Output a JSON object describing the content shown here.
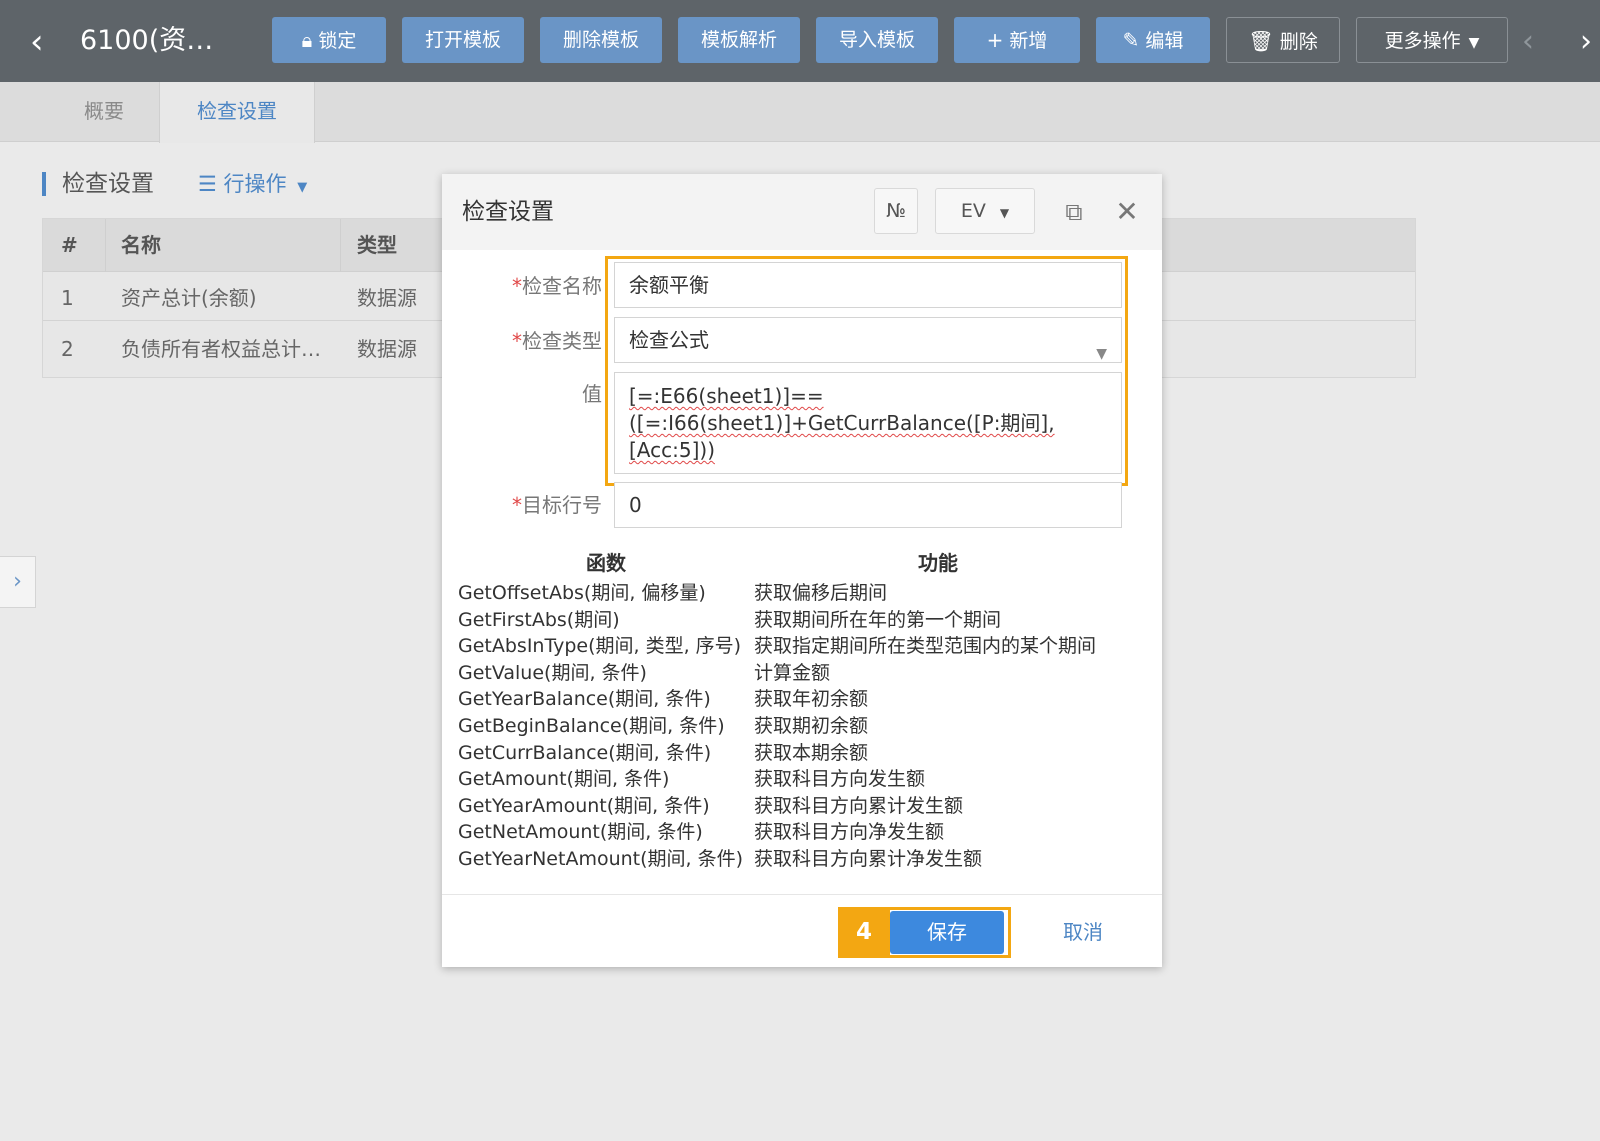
{
  "toolbar": {
    "title": "6100(资…",
    "buttons": {
      "lock": "锁定",
      "open_template": "打开模板",
      "delete_template": "删除模板",
      "parse_template": "模板解析",
      "import_template": "导入模板",
      "add": "新增",
      "edit": "编辑",
      "delete": "删除",
      "more": "更多操作"
    },
    "icons": {
      "back": "chevron-left-icon",
      "lock": "lock-icon",
      "add": "plus-icon",
      "edit": "edit-icon",
      "delete": "trash-icon",
      "more": "caret-down-icon",
      "prev": "chevron-left-icon",
      "next": "chevron-right-icon"
    }
  },
  "tabs": [
    {
      "label": "概要",
      "active": false
    },
    {
      "label": "检查设置",
      "active": true
    }
  ],
  "section": {
    "title": "检查设置",
    "row_ops": "行操作"
  },
  "table": {
    "columns": [
      "#",
      "名称",
      "类型"
    ],
    "rows": [
      {
        "num": "1",
        "name": "资产总计(余额)",
        "type": "数据源"
      },
      {
        "num": "2",
        "name": "负债所有者权益总计…",
        "type": "数据源"
      }
    ]
  },
  "modal": {
    "title": "检查设置",
    "header_buttons": {
      "no": "№",
      "ev": "EV"
    },
    "fields": {
      "name_label": "检查名称",
      "name_value": "余额平衡",
      "type_label": "检查类型",
      "type_value": "检查公式",
      "value_label": "值",
      "value_line1": "[=:E66(sheet1)]==",
      "value_line2": "([=:I66(sheet1)]+GetCurrBalance([P:期间], [Acc:5]))",
      "target_label": "目标行号",
      "target_value": "0"
    },
    "functions": {
      "col_func": "函数",
      "col_desc": "功能",
      "rows": [
        {
          "name": "GetOffsetAbs(期间, 偏移量)",
          "desc": "获取偏移后期间"
        },
        {
          "name": "GetFirstAbs(期间)",
          "desc": "获取期间所在年的第一个期间"
        },
        {
          "name": "GetAbsInType(期间, 类型, 序号)",
          "desc": "获取指定期间所在类型范围内的某个期间"
        },
        {
          "name": "GetValue(期间, 条件)",
          "desc": "计算金额"
        },
        {
          "name": "GetYearBalance(期间, 条件)",
          "desc": "获取年初余额"
        },
        {
          "name": "GetBeginBalance(期间, 条件)",
          "desc": "获取期初余额"
        },
        {
          "name": "GetCurrBalance(期间, 条件)",
          "desc": "获取本期余额"
        },
        {
          "name": "GetAmount(期间, 条件)",
          "desc": "获取科目方向发生额"
        },
        {
          "name": "GetYearAmount(期间, 条件)",
          "desc": "获取科目方向累计发生额"
        },
        {
          "name": "GetNetAmount(期间, 条件)",
          "desc": "获取科目方向净发生额"
        },
        {
          "name": "GetYearNetAmount(期间, 条件)",
          "desc": "获取科目方向累计净发生额"
        }
      ]
    },
    "step_number": "4",
    "save": "保存",
    "cancel": "取消"
  },
  "colors": {
    "accent": "#6a95c6",
    "highlight": "#f3a712",
    "primary_button": "#3d89de"
  }
}
